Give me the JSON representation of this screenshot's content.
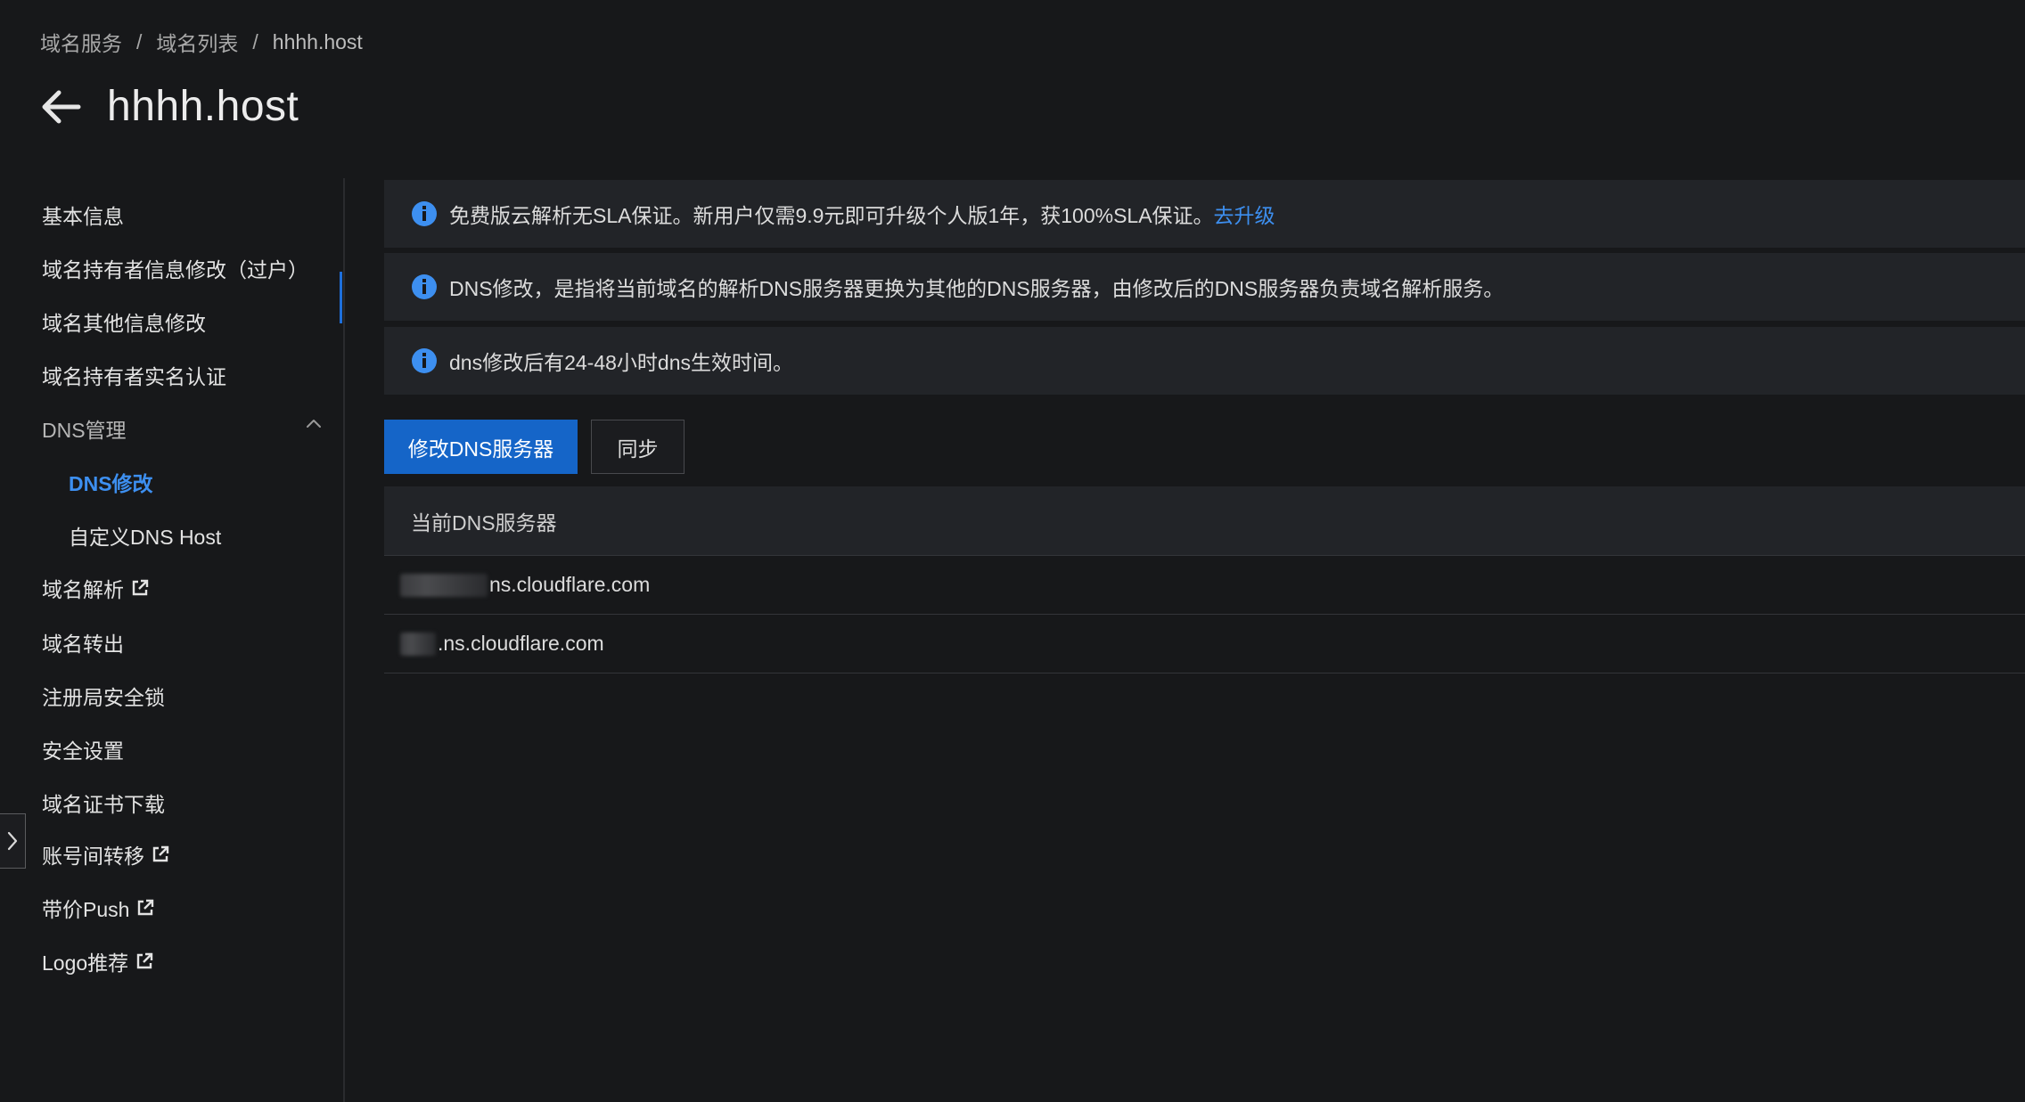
{
  "breadcrumb": {
    "items": [
      "域名服务",
      "域名列表",
      "hhhh.host"
    ],
    "separator": "/"
  },
  "header": {
    "title": "hhhh.host"
  },
  "sidebar": {
    "items": [
      {
        "label": "基本信息"
      },
      {
        "label": "域名持有者信息修改（过户）"
      },
      {
        "label": "域名其他信息修改"
      },
      {
        "label": "域名持有者实名认证"
      },
      {
        "label": "DNS管理"
      },
      {
        "label": "DNS修改"
      },
      {
        "label": "自定义DNS Host"
      },
      {
        "label": "域名解析"
      },
      {
        "label": "域名转出"
      },
      {
        "label": "注册局安全锁"
      },
      {
        "label": "安全设置"
      },
      {
        "label": "域名证书下载"
      },
      {
        "label": "账号间转移"
      },
      {
        "label": "带价Push"
      },
      {
        "label": "Logo推荐"
      }
    ]
  },
  "notices": [
    {
      "text": "免费版云解析无SLA保证。新用户仅需9.9元即可升级个人版1年，获100%SLA保证。",
      "link": "去升级"
    },
    {
      "text": "DNS修改，是指将当前域名的解析DNS服务器更换为其他的DNS服务器，由修改后的DNS服务器负责域名解析服务。"
    },
    {
      "text": "dns修改后有24-48小时dns生效时间。"
    }
  ],
  "actions": {
    "modify_label": "修改DNS服务器",
    "sync_label": "同步"
  },
  "dns_table": {
    "header": "当前DNS服务器",
    "rows": [
      {
        "value": "ns.cloudflare.com"
      },
      {
        "value": ".ns.cloudflare.com"
      }
    ]
  },
  "colors": {
    "background": "#17181a",
    "accent": "#1565c8",
    "link": "#3d8ff0",
    "info_icon": "#3d8ff0"
  },
  "icons": {
    "back": "arrow-left-icon",
    "info": "info-circle-icon",
    "external": "external-link-icon",
    "chevron_up": "chevron-up-icon",
    "chevron_right": "chevron-right-icon"
  }
}
